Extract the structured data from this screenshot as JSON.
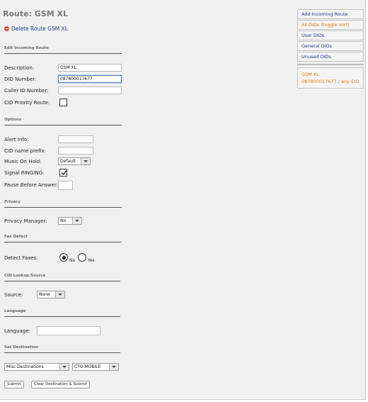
{
  "page": {
    "title": "Route: GSM XL",
    "delete_link": "Delete Route GSM XL"
  },
  "sections": {
    "edit": "Edit Incoming Route",
    "options": "Options",
    "privacy": "Privacy",
    "fax": "Fax Detect",
    "cid_lookup": "CID Lookup Source",
    "language": "Language",
    "destination": "Set Destination"
  },
  "fields": {
    "description": {
      "label": "Description:",
      "value": "GSM XL"
    },
    "did_number": {
      "label": "DID Number:",
      "value": "087800017677"
    },
    "caller_id": {
      "label": "Caller ID Number:",
      "value": ""
    },
    "cid_priority": {
      "label": "CID Priority Route:",
      "checked": false
    },
    "alert_info": {
      "label": "Alert Info:",
      "value": ""
    },
    "cid_prefix": {
      "label": "CID name prefix:",
      "value": ""
    },
    "moh": {
      "label": "Music On Hold:",
      "selected": "Default"
    },
    "ringing": {
      "label": "Signal RINGING:",
      "checked": true
    },
    "pause": {
      "label": "Pause Before Answer:",
      "value": ""
    },
    "privacy_manager": {
      "label": "Privacy Manager:",
      "selected": "No"
    },
    "detect_faxes": {
      "label": "Detect Faxes:",
      "options": [
        "No",
        "Yes"
      ],
      "selected": "No"
    },
    "source": {
      "label": "Source:",
      "selected": "None"
    },
    "language": {
      "label": "Language:",
      "value": ""
    },
    "destination": {
      "category": "Misc Destinations",
      "target": "CTO MOBILE"
    }
  },
  "buttons": {
    "submit": "Submit",
    "clear_submit": "Clear Destination & Submit"
  },
  "sidebar": {
    "items": [
      {
        "label": "Add Incoming Route",
        "color": "#1a3d8a"
      },
      {
        "label": "All DIDs (toggle sort)",
        "color": "#e07a10"
      },
      {
        "label": "User DIDs",
        "color": "#1a3d8a"
      },
      {
        "label": "General DIDs",
        "color": "#1a3d8a"
      },
      {
        "label": "Unused DIDs",
        "color": "#1a3d8a"
      }
    ],
    "current_route": {
      "name": "GSM XL",
      "detail": "087800017677 / any CID"
    }
  },
  "colors": {
    "link": "#1a3d8a",
    "active": "#e07a10",
    "delete_icon": "#e0453a",
    "background": "#f0f0f0"
  }
}
